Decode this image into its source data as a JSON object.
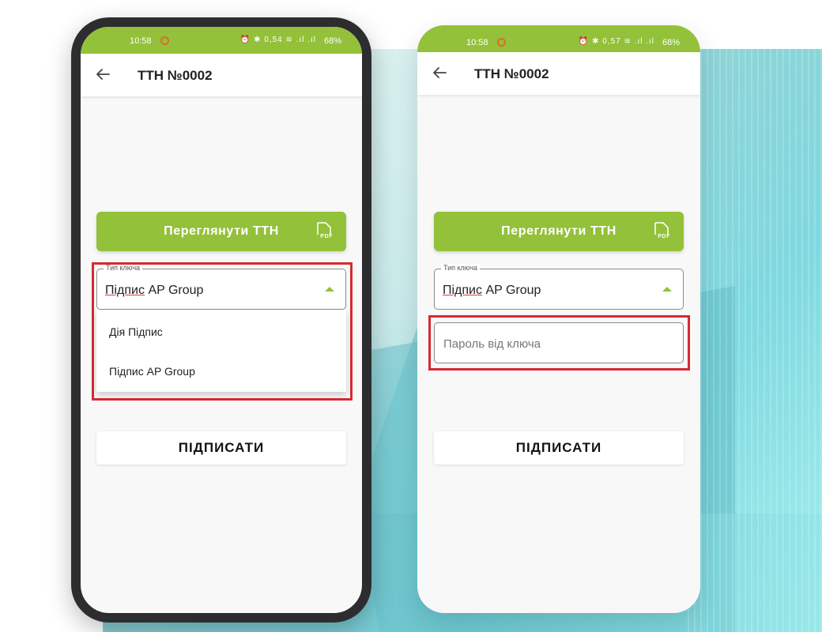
{
  "status_bar": {
    "time": "10:58",
    "left_icons": "⏰ ✱ 0,54 ≋ .ıl .ıl",
    "right_icons": "⏰ ✱ 0,57 ≋ .ıl .ıl",
    "battery": "68%"
  },
  "app_bar": {
    "title": "ТТН №0002"
  },
  "view_button": {
    "label": "Переглянути ТТН",
    "icon_text": "PDF"
  },
  "key_type": {
    "legend": "Тип ключа",
    "value_underlined": "Підпис",
    "value_rest": " AP Group"
  },
  "dropdown": {
    "options": [
      "Дія Підпис",
      "Підпис AP Group"
    ]
  },
  "password": {
    "placeholder": "Пароль від ключа"
  },
  "sign_button": {
    "label": "ПІДПИСАТИ"
  },
  "colors": {
    "accent": "#93c13a",
    "highlight": "#d42a32"
  }
}
